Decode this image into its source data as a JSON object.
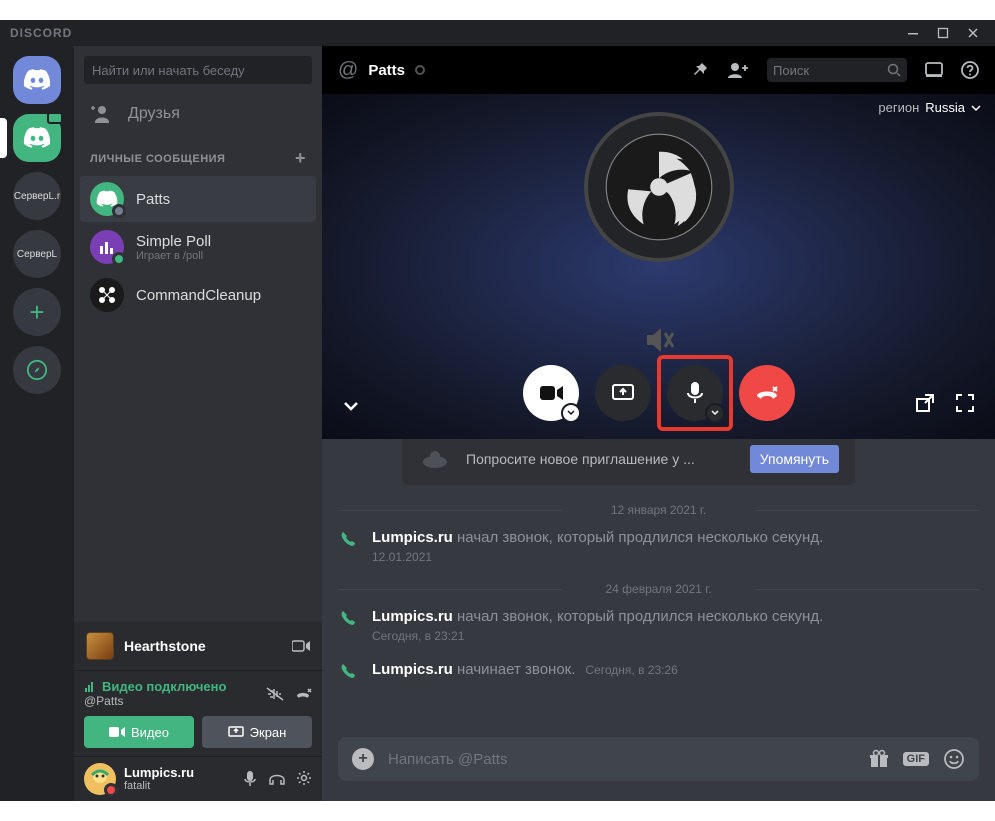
{
  "titlebar": {
    "app_name": "DISCORD"
  },
  "guilds": {
    "server1": "СерверL.r",
    "server2": "СерверL"
  },
  "sidebar": {
    "search_placeholder": "Найти или начать беседу",
    "friends_label": "Друзья",
    "dm_header": "ЛИЧНЫЕ СООБЩЕНИЯ",
    "dms": [
      {
        "name": "Patts",
        "sub": ""
      },
      {
        "name": "Simple Poll",
        "sub": "Играет в /poll"
      },
      {
        "name": "CommandCleanup",
        "sub": ""
      }
    ]
  },
  "panels": {
    "game": "Hearthstone",
    "voice_status": "Видео подключено",
    "voice_channel": "@Patts",
    "video_btn": "Видео",
    "screen_btn": "Экран",
    "username": "Lumpics.ru",
    "usertag": "fatalit"
  },
  "header": {
    "name": "Patts",
    "search_placeholder": "Поиск",
    "region_label": "регион",
    "region_name": "Russia"
  },
  "invite": {
    "text": "Попросите новое приглашение у ...",
    "button": "Упомянуть"
  },
  "dates": {
    "d1": "12 января 2021 г.",
    "d2": "24 февраля 2021 г."
  },
  "messages": [
    {
      "author": "Lumpics.ru",
      "text": " начал звонок, который продлился несколько секунд.",
      "time": "12.01.2021"
    },
    {
      "author": "Lumpics.ru",
      "text": " начал звонок, который продлился несколько секунд.",
      "time": "Сегодня, в 23:21"
    },
    {
      "author": "Lumpics.ru",
      "text": " начинает звонок.",
      "time": "Сегодня, в 23:26"
    }
  ],
  "input": {
    "placeholder": "Написать @Patts"
  }
}
